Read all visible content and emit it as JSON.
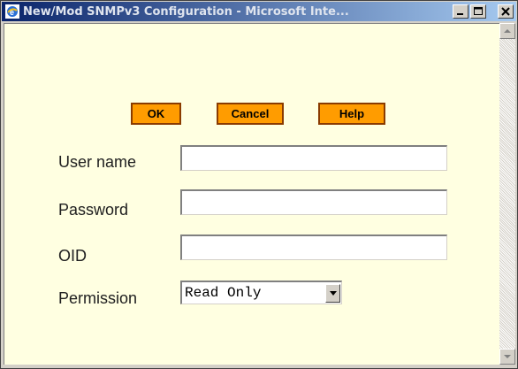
{
  "window": {
    "title": "New/Mod SNMPv3 Configuration - Microsoft Inte...",
    "icons": {
      "app": "ie-icon",
      "minimize": "minimize-icon",
      "maximize": "maximize-icon",
      "close": "close-icon"
    }
  },
  "toolbar": {
    "ok_label": "OK",
    "cancel_label": "Cancel",
    "help_label": "Help"
  },
  "form": {
    "username": {
      "label": "User name",
      "value": ""
    },
    "password": {
      "label": "Password",
      "value": ""
    },
    "oid": {
      "label": "OID",
      "value": ""
    },
    "permission": {
      "label": "Permission",
      "selected": "Read Only"
    }
  },
  "colors": {
    "content_bg": "#ffffe1",
    "button_bg": "#ff9c00",
    "button_border": "#8a3b00",
    "titlebar_start": "#0a246a",
    "titlebar_end": "#a6caf0"
  }
}
